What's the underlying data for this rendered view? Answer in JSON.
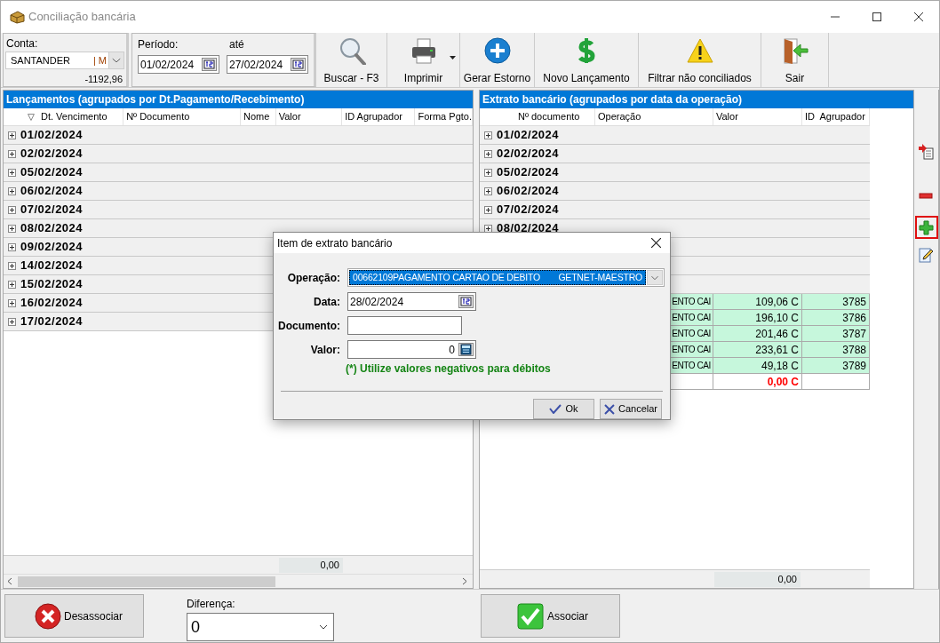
{
  "window": {
    "title": "Conciliação bancária"
  },
  "toolbar": {
    "account": {
      "label": "Conta:",
      "value": "SANTANDER",
      "value_tail": "| M",
      "balance": "-1192,96"
    },
    "period": {
      "label": "Período:",
      "from": "01/02/2024",
      "to_label": "até",
      "to": "27/02/2024"
    },
    "buttons": [
      {
        "label": "Buscar - F3",
        "dropdown": false
      },
      {
        "label": "Imprimir",
        "dropdown": true
      },
      {
        "label": "Gerar Estorno",
        "dropdown": false
      },
      {
        "label": "Novo Lançamento",
        "dropdown": false
      },
      {
        "label": "Filtrar não conciliados",
        "dropdown": false
      },
      {
        "label": "Sair",
        "dropdown": false
      }
    ]
  },
  "left_panel": {
    "title": "Lançamentos (agrupados por Dt.Pagamento/Recebimento)",
    "columns": [
      "Dt. Vencimento",
      "Nº Documento",
      "Nome",
      "Valor",
      "ID Agrupador",
      "Forma Pgto."
    ],
    "groups": [
      "01/02/2024",
      "02/02/2024",
      "05/02/2024",
      "06/02/2024",
      "07/02/2024",
      "08/02/2024",
      "09/02/2024",
      "14/02/2024",
      "15/02/2024",
      "16/02/2024",
      "17/02/2024"
    ],
    "total": "0,00"
  },
  "right_panel": {
    "title": "Extrato bancário (agrupados por data da operação)",
    "columns": [
      "Nº documento",
      "Operação",
      "Valor",
      "ID  Agrupador"
    ],
    "rows": [
      {
        "kind": "group",
        "date": "01/02/2024"
      },
      {
        "kind": "group",
        "date": "02/02/2024"
      },
      {
        "kind": "group",
        "date": "05/02/2024"
      },
      {
        "kind": "group",
        "date": "06/02/2024"
      },
      {
        "kind": "group",
        "date": "07/02/2024"
      },
      {
        "kind": "group",
        "date": "08/02/2024"
      },
      {
        "kind": "group"
      },
      {
        "kind": "group"
      },
      {
        "kind": "group"
      },
      {
        "kind": "detail",
        "operation": "ENTO CAI",
        "value": "109,06 C",
        "id": "3785"
      },
      {
        "kind": "detail",
        "operation": "ENTO CAI",
        "value": "196,10 C",
        "id": "3786"
      },
      {
        "kind": "detail",
        "operation": "ENTO CAI",
        "value": "201,46 C",
        "id": "3787"
      },
      {
        "kind": "detail",
        "operation": "ENTO CAI",
        "value": "233,61 C",
        "id": "3788"
      },
      {
        "kind": "detail",
        "operation": "ENTO CAI",
        "value": "49,18 C",
        "id": "3789"
      },
      {
        "kind": "total",
        "value": "0,00 C"
      }
    ],
    "total": "0,00"
  },
  "side_toolbar": [
    {
      "selected": false
    },
    {
      "selected": false
    },
    {
      "selected": true
    },
    {
      "selected": false
    }
  ],
  "bottom": {
    "unlink_button": "Desassociar",
    "difference_label": "Diferença:",
    "difference_value": "0",
    "link_button": "Associar"
  },
  "dialog": {
    "title": "Item de extrato bancário",
    "fields": [
      {
        "kind": "combo",
        "label": "Operação:",
        "value": "00662109PAGAMENTO CARTAO DE DEBITO",
        "value_tail": "GETNET-MAESTRO"
      },
      {
        "kind": "date",
        "label": "Data:",
        "value": "28/02/2024"
      },
      {
        "kind": "text",
        "label": "Documento:"
      },
      {
        "kind": "calc",
        "label": "Valor:",
        "value": "0"
      }
    ],
    "note": "(*) Utilize valores negativos para débitos",
    "buttons": [
      "Ok",
      "Cancelar"
    ]
  }
}
